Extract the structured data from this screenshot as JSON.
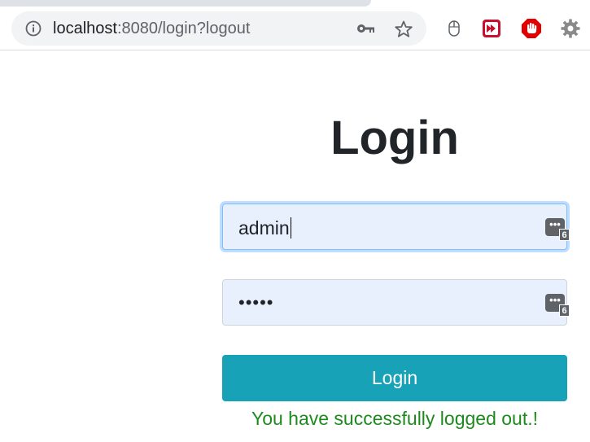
{
  "browser": {
    "url_host": "localhost",
    "url_rest": ":8080/login?logout"
  },
  "page": {
    "title": "Login",
    "username_value": "admin",
    "password_mask": "•••••",
    "username_badge_count": "6",
    "password_badge_count": "6",
    "login_button_label": "Login",
    "message": "You have successfully logged out.!"
  },
  "colors": {
    "button": "#17a2b8",
    "message": "#1e8a1e",
    "field_autofill": "#e8f0fe"
  }
}
